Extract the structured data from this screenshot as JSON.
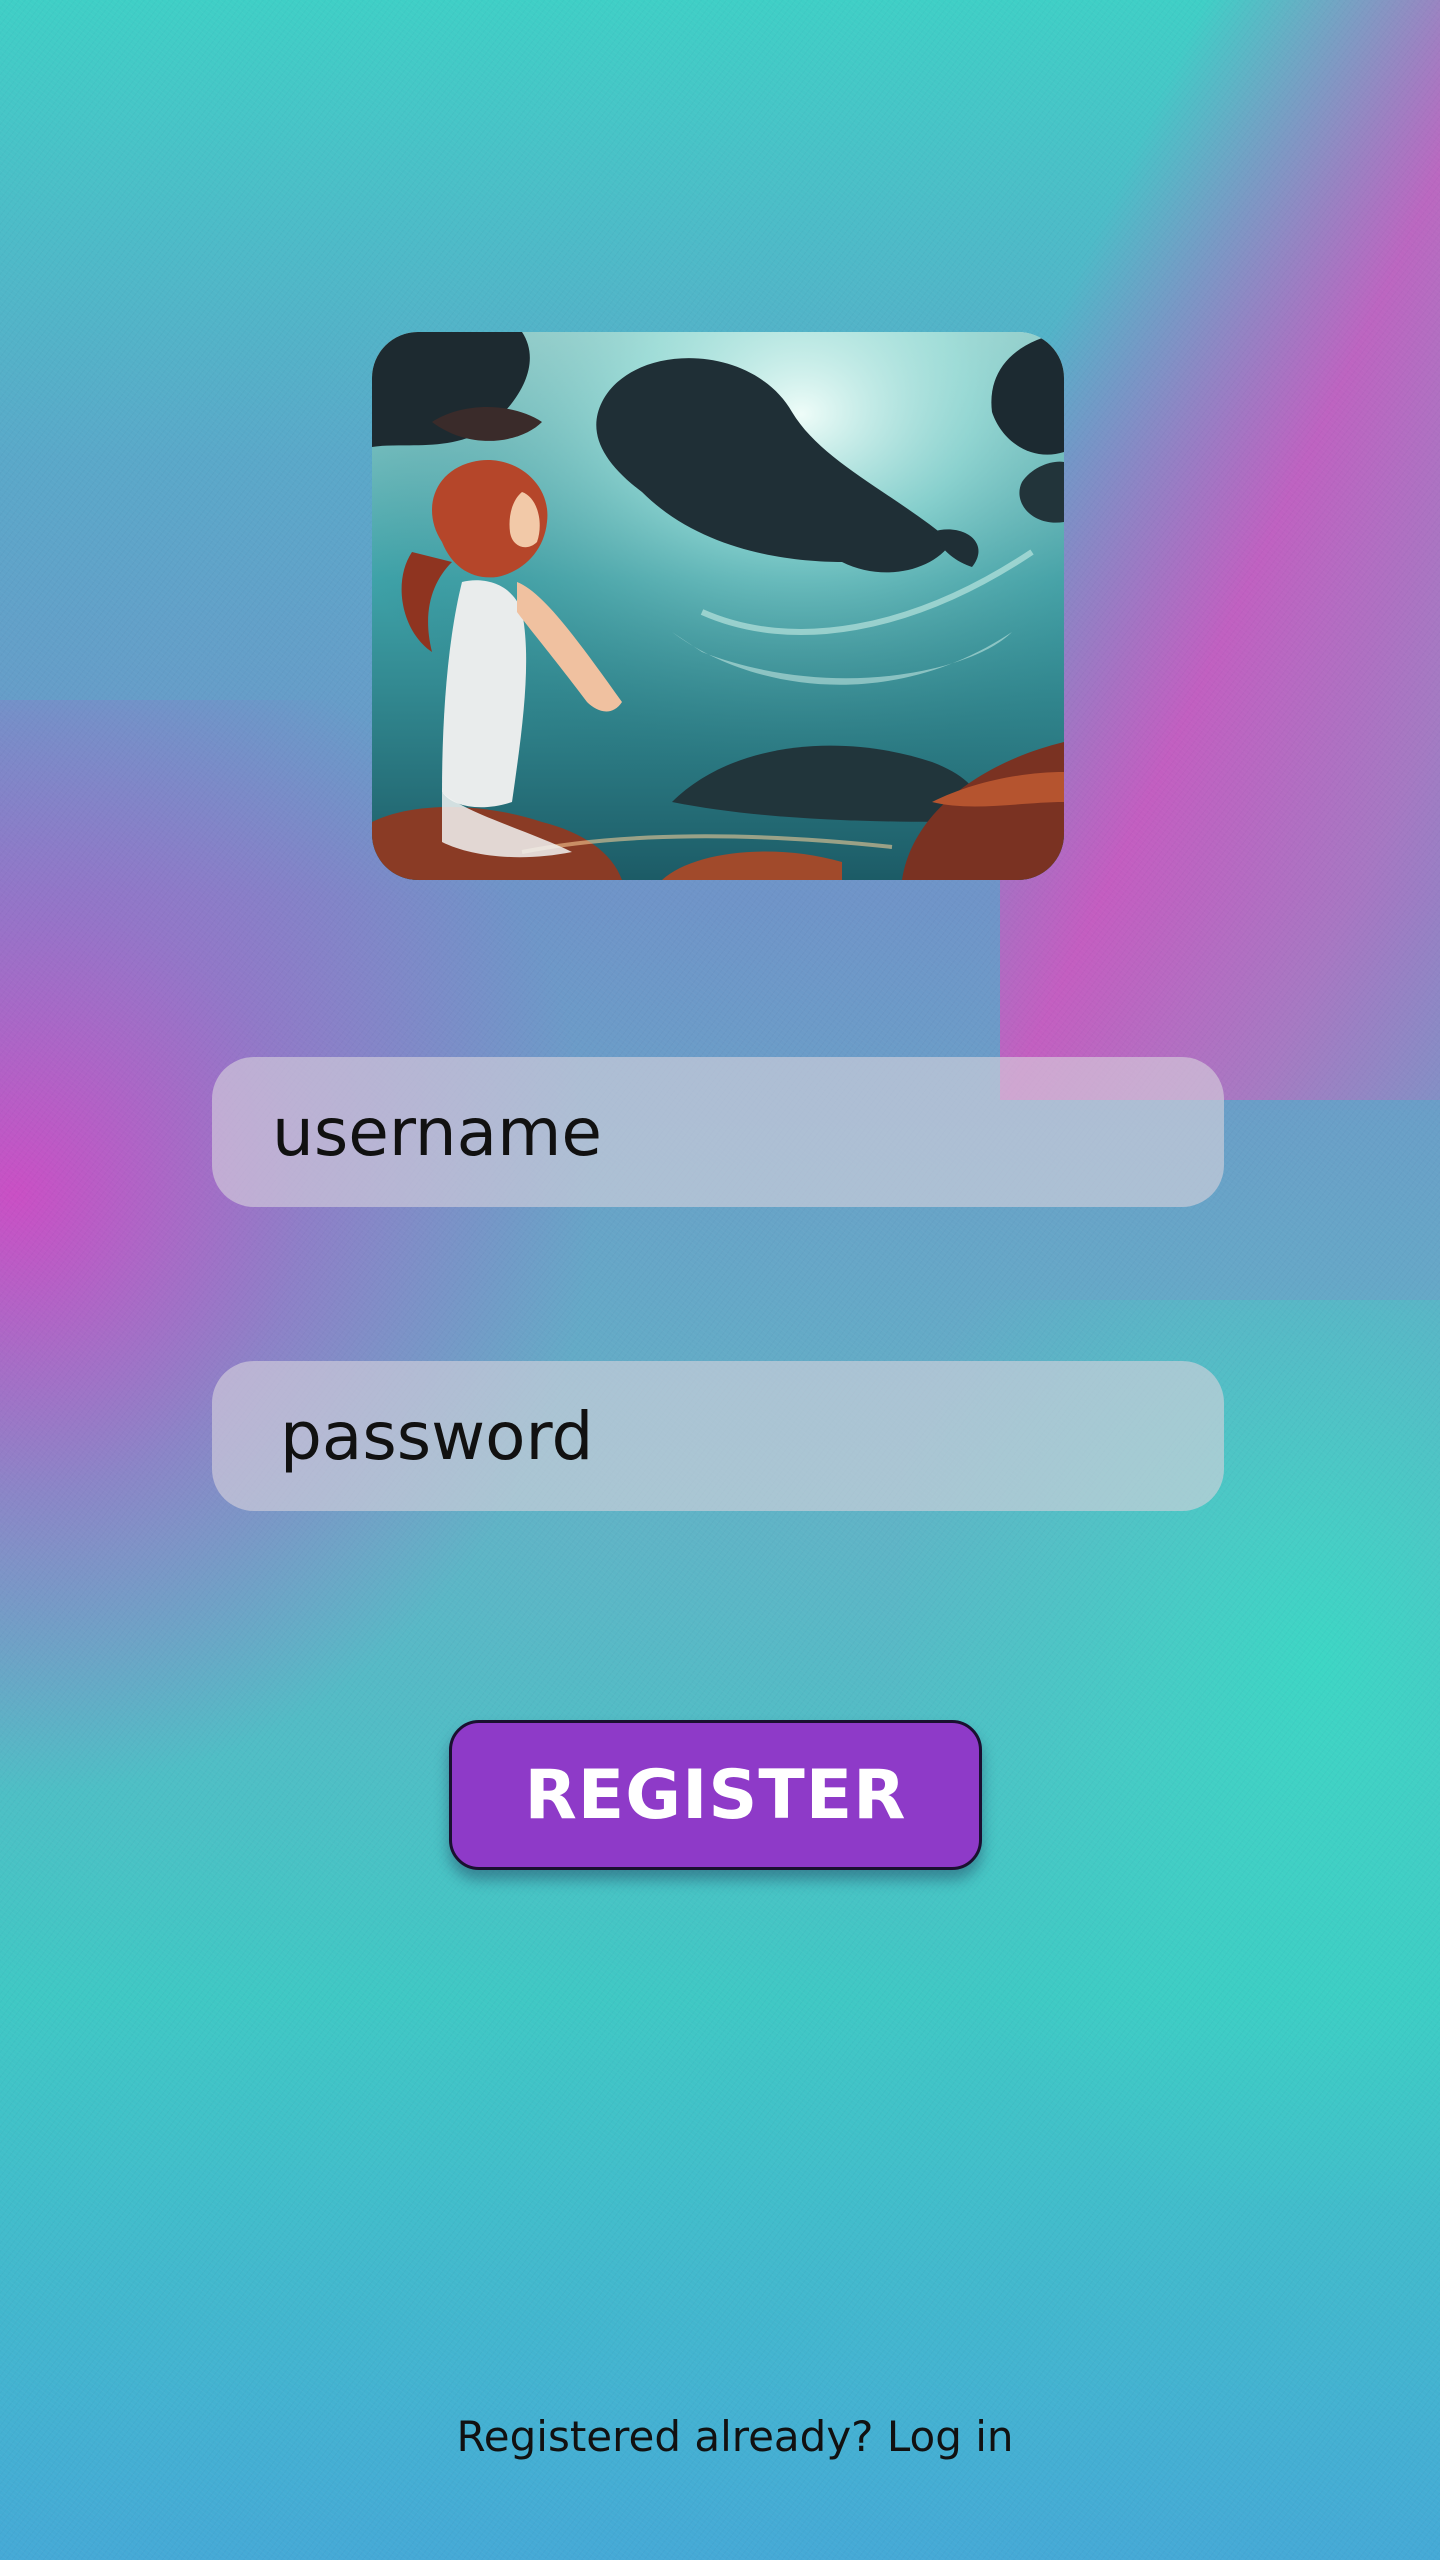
{
  "form": {
    "username_placeholder": "username",
    "password_placeholder": "password",
    "register_label": "REGISTER"
  },
  "footer": {
    "prompt": "Registered already?",
    "login_label": "Log in"
  },
  "colors": {
    "register_button": "#8e3ac8",
    "field_background": "#d7d2dc",
    "accent_magenta": "#d64abe",
    "accent_teal": "#3fcfc6"
  },
  "images": {
    "hero": "underwater-illustration-girl-and-whale"
  }
}
